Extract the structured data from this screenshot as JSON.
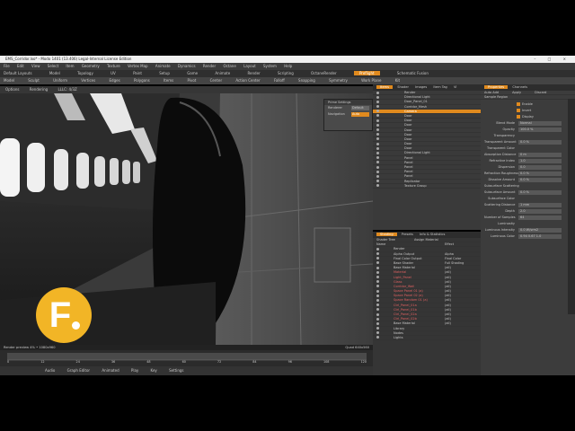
{
  "app": {
    "window_title": "EMS_Corridor.lxo* - Modo 1401 (13.406) Legal-Internal License Edition",
    "window_buttons": "– □ ×",
    "default_layout": "Default Layouts"
  },
  "menubar": [
    "File",
    "Edit",
    "View",
    "Select",
    "Item",
    "Geometry",
    "Texture",
    "Vertex Map",
    "Animate",
    "Dynamics",
    "Render",
    "Octane",
    "Layout",
    "System",
    "Help"
  ],
  "layout_tabs": [
    "Model",
    "Topology",
    "UV",
    "Paint",
    "Setup",
    "Game",
    "Animate",
    "Render",
    "Scripting",
    "OctaneRender",
    "Preflight",
    "Schematic Fusion"
  ],
  "active_layout_tab": "Preflight",
  "toolbar": [
    "Model",
    "Sculpt",
    "Uniform",
    "Vertices",
    "Edges",
    "Polygons",
    "Items",
    "Pivot",
    "Center",
    "Action Center",
    "Falloff",
    "Snapping",
    "Symmetry",
    "Work Plane",
    "Kit"
  ],
  "viewport_header": [
    "Options",
    "Rendering",
    "LLLC: 4/3Z"
  ],
  "viewport_status": "Render preview   4% • 1080x960",
  "viewport_status_right": "Quad 640x560",
  "popup": {
    "title": "Prime Settings",
    "rows": [
      {
        "label": "Renderer",
        "value": "Default"
      },
      {
        "label": "Navigation",
        "value": "Auto"
      }
    ]
  },
  "scene_panel": {
    "tabs": [
      "Items",
      "Shader",
      "Images",
      "Item Tag",
      "Vl"
    ],
    "items": [
      {
        "label": "Render",
        "selected": false
      },
      {
        "label": "Directional Light",
        "selected": false
      },
      {
        "label": "Door_Panel_01",
        "selected": false
      },
      {
        "label": "Corridor_Mesh",
        "selected": false
      },
      {
        "label": "Camera",
        "selected": true
      },
      {
        "label": "Door",
        "selected": false
      },
      {
        "label": "Door",
        "selected": false
      },
      {
        "label": "Door",
        "selected": false
      },
      {
        "label": "Door",
        "selected": false
      },
      {
        "label": "Door",
        "selected": false
      },
      {
        "label": "Door",
        "selected": false
      },
      {
        "label": "Door",
        "selected": false
      },
      {
        "label": "Door",
        "selected": false
      },
      {
        "label": "Directional Light",
        "selected": false
      },
      {
        "label": "Panel",
        "selected": false
      },
      {
        "label": "Panel",
        "selected": false
      },
      {
        "label": "Panel",
        "selected": false
      },
      {
        "label": "Panel",
        "selected": false
      },
      {
        "label": "Panel",
        "selected": false
      },
      {
        "label": "Replicator",
        "selected": false
      },
      {
        "label": "Texture Group",
        "selected": false
      }
    ]
  },
  "shader_panel": {
    "tabs": [
      "Shading",
      "Presets",
      "Info & Statistics"
    ],
    "filter_label": "Shader Tree",
    "assign_label": "Assign Material",
    "columns": [
      "Name",
      "Effect"
    ],
    "items": [
      {
        "label": "Render",
        "effect": ""
      },
      {
        "label": "Alpha Output",
        "effect": "Alpha"
      },
      {
        "label": "Final Color Output",
        "effect": "Final Color"
      },
      {
        "label": "Base Shader",
        "effect": "Full Shading"
      },
      {
        "label": "Base Material",
        "effect": "(all)"
      },
      {
        "label": "Material",
        "effect": "(all)"
      },
      {
        "label": "Light_Panel",
        "effect": "(all)"
      },
      {
        "label": "Glass",
        "effect": "(all)"
      },
      {
        "label": "Corridor_Wall",
        "effect": "(all)"
      },
      {
        "label": "Space Panel 01 (a)",
        "effect": "(all)"
      },
      {
        "label": "Space Panel 02 (a)",
        "effect": "(all)"
      },
      {
        "label": "Space Random 01 (a)",
        "effect": "(all)"
      },
      {
        "label": "Ctrl_Panel_01a",
        "effect": "(all)"
      },
      {
        "label": "Ctrl_Panel_01b",
        "effect": "(all)"
      },
      {
        "label": "Ctrl_Panel_02a",
        "effect": "(all)"
      },
      {
        "label": "Ctrl_Panel_02b",
        "effect": "(all)"
      },
      {
        "label": "Base Material",
        "effect": "(all)"
      },
      {
        "label": "Library",
        "effect": ""
      },
      {
        "label": "Nodes",
        "effect": ""
      },
      {
        "label": "Lights",
        "effect": ""
      }
    ]
  },
  "properties": {
    "tabs": [
      "Properties",
      "Channels"
    ],
    "auto_add": "Auto Add",
    "apply": "Apply",
    "discard": "Discard",
    "section": "Sample Region",
    "checks": [
      "Enable",
      "Invert",
      "Display"
    ],
    "rows": [
      {
        "label": "Blend Mode",
        "value": "Normal"
      },
      {
        "label": "Opacity",
        "value": "100.0 %"
      },
      {
        "label": "Transparency",
        "value": ""
      },
      {
        "label": "Transparent Amount",
        "value": "0.0 %"
      },
      {
        "label": "Transparent Color",
        "value": ""
      },
      {
        "label": "Absorption Distance",
        "value": "0 m"
      },
      {
        "label": "Refractive Index",
        "value": "1.0"
      },
      {
        "label": "Dispersion",
        "value": "0.0"
      },
      {
        "label": "Refraction Roughness",
        "value": "0.0 %"
      },
      {
        "label": "Dissolve Amount",
        "value": "0.0 %"
      },
      {
        "label": "Subsurface Scattering",
        "value": ""
      },
      {
        "label": "Subsurface Amount",
        "value": "0.0 %"
      },
      {
        "label": "Subsurface Color",
        "value": ""
      },
      {
        "label": "Scattering Distance",
        "value": "1 mm"
      },
      {
        "label": "Depth",
        "value": "2.0"
      },
      {
        "label": "Number of Samples",
        "value": "64"
      },
      {
        "label": "Luminosity",
        "value": ""
      },
      {
        "label": "Luminous Intensity",
        "value": "0.0 W/srm2"
      },
      {
        "label": "Luminous Color",
        "value": "0.94   0.67   1.0"
      }
    ]
  },
  "playbar": [
    "Audio",
    "Graph Editor",
    "Animated",
    "Play",
    "Key",
    "Settings"
  ],
  "timeline_ticks": [
    "0",
    "12",
    "24",
    "36",
    "48",
    "60",
    "72",
    "84",
    "96",
    "108",
    "120"
  ],
  "logo": {
    "letter": "F",
    "color": "#f2b526"
  },
  "colors": {
    "accent": "#e08a1e",
    "panel": "#3a3a3a"
  }
}
